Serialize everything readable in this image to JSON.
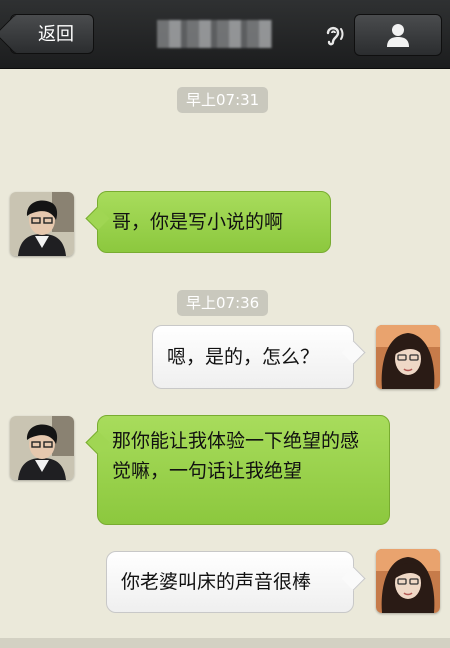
{
  "header": {
    "back_label": "返回",
    "contact_name": "",
    "earpiece_icon": "ear-icon",
    "profile_icon": "person-icon"
  },
  "messages": [
    {
      "type": "timestamp",
      "text": "早上07:31"
    },
    {
      "type": "received",
      "text": "哥，你是写小说的啊",
      "avatar": "male-avatar"
    },
    {
      "type": "timestamp",
      "text": "早上07:36"
    },
    {
      "type": "sent",
      "text": "嗯，是的，怎么？",
      "avatar": "female-avatar"
    },
    {
      "type": "received",
      "text": "那你能让我体验一下绝望的感觉嘛，一句话让我绝望",
      "avatar": "male-avatar"
    },
    {
      "type": "sent",
      "text": "你老婆叫床的声音很棒",
      "avatar": "female-avatar"
    }
  ]
}
